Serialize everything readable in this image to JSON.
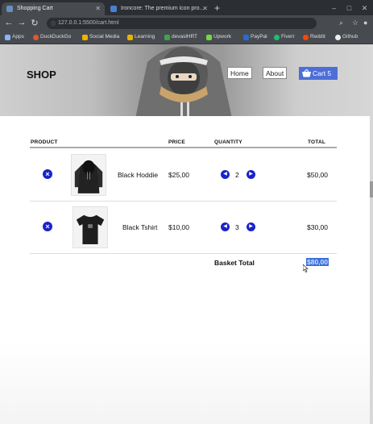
{
  "browser": {
    "tabs": [
      {
        "title": "Shopping Cart",
        "favicon_color": "#6c8ebf",
        "active": true
      },
      {
        "title": "Ironcore: The premium icon pro...",
        "favicon_color": "#4a7fd1",
        "active": false
      }
    ],
    "url": "127.0.0.1:5500/cart.html",
    "bookmarks": [
      {
        "label": "Apps",
        "color": "#8ab4f8"
      },
      {
        "label": "DuckDuckGo",
        "color": "#de5833"
      },
      {
        "label": "Social Media",
        "color": "#e8b400"
      },
      {
        "label": "Learning",
        "color": "#e8b400"
      },
      {
        "label": "devaslHRT",
        "color": "#3fa34d"
      },
      {
        "label": "Upwork",
        "color": "#6fda44"
      },
      {
        "label": "PayPal",
        "color": "#2a6ad3"
      },
      {
        "label": "Fiverr",
        "color": "#1dbf73"
      },
      {
        "label": "Reddit",
        "color": "#ff4500"
      },
      {
        "label": "Github",
        "color": "#eeeeee"
      }
    ]
  },
  "header": {
    "brand": "SHOP",
    "nav": {
      "home": "Home",
      "about": "About"
    },
    "cart_label": "Cart 5",
    "accent": "#4d6ed8"
  },
  "cart": {
    "columns": {
      "product": "PRODUCT",
      "price": "PRICE",
      "quantity": "QUANTITY",
      "total": "TOTAL"
    },
    "items": [
      {
        "name": "Black Hoddie",
        "price": "$25,00",
        "quantity": "2",
        "total": "$50,00",
        "image": "hoodie"
      },
      {
        "name": "Black Tshirt",
        "price": "$10,00",
        "quantity": "3",
        "total": "$30,00",
        "image": "tshirt"
      }
    ],
    "basket_total_label": "Basket Total",
    "basket_total_value": "$80,00",
    "button_color": "#1a22cc"
  }
}
